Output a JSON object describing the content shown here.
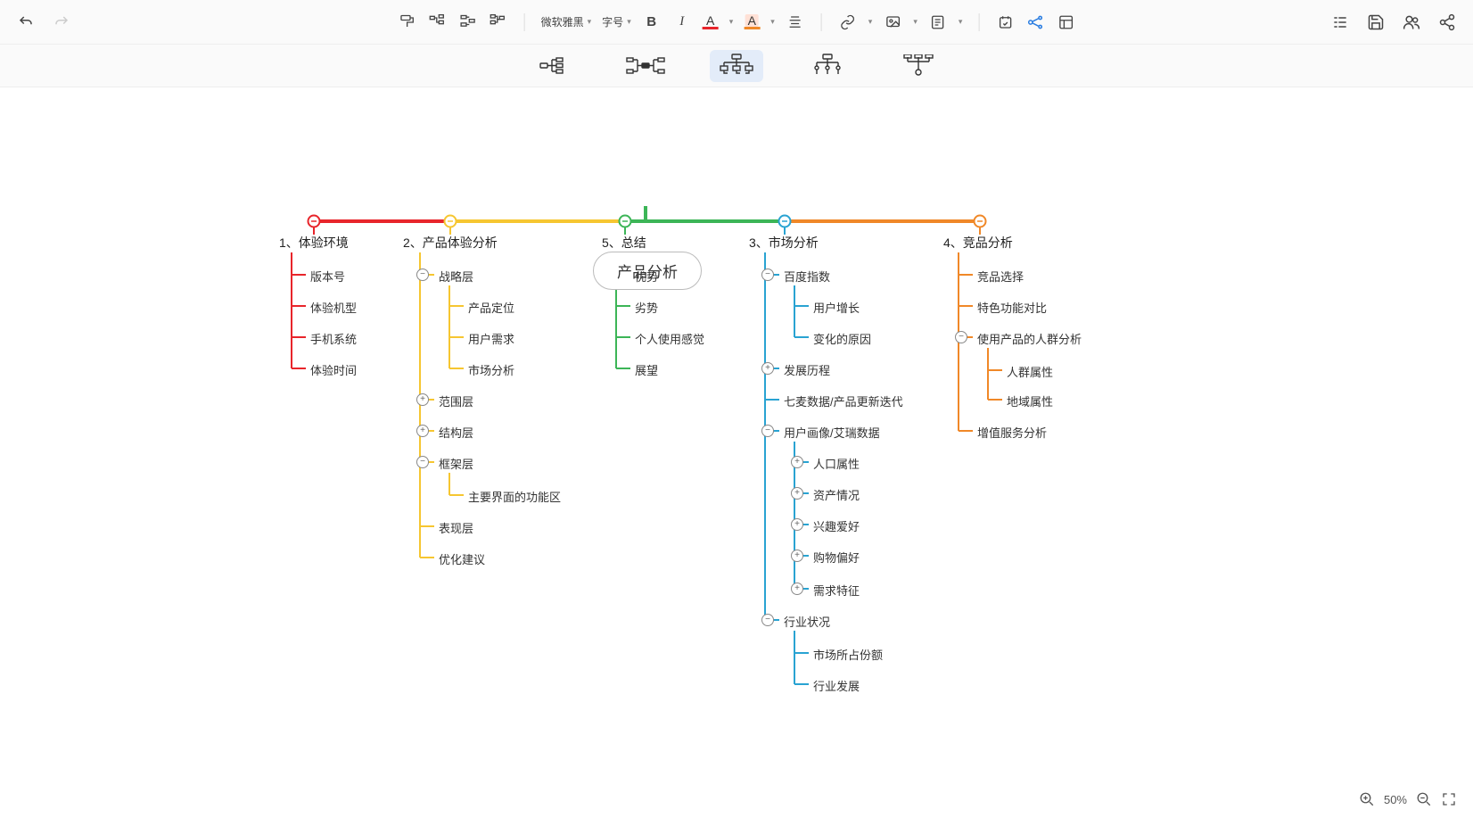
{
  "toolbar": {
    "font_family": "微软雅黑",
    "font_size_label": "字号"
  },
  "zoom": {
    "percent": "50%"
  },
  "mindmap": {
    "root": {
      "title": "产品分析"
    },
    "branches": [
      {
        "id": "b1",
        "title": "1、体验环境",
        "color": "#e8252b",
        "children": [
          {
            "label": "版本号"
          },
          {
            "label": "体验机型"
          },
          {
            "label": "手机系统"
          },
          {
            "label": "体验时间"
          }
        ]
      },
      {
        "id": "b2",
        "title": "2、产品体验分析",
        "color": "#f6c631",
        "children": [
          {
            "label": "战略层",
            "toggle": "minus",
            "children": [
              {
                "label": "产品定位"
              },
              {
                "label": "用户需求"
              },
              {
                "label": "市场分析"
              }
            ]
          },
          {
            "label": "范围层",
            "toggle": "plus"
          },
          {
            "label": "结构层",
            "toggle": "plus"
          },
          {
            "label": "框架层",
            "toggle": "minus",
            "children": [
              {
                "label": "主要界面的功能区"
              }
            ]
          },
          {
            "label": "表现层"
          },
          {
            "label": "优化建议"
          }
        ]
      },
      {
        "id": "b3",
        "title": "5、总结",
        "color": "#3cb557",
        "children": [
          {
            "label": "优势"
          },
          {
            "label": "劣势"
          },
          {
            "label": "个人使用感觉"
          },
          {
            "label": "展望"
          }
        ]
      },
      {
        "id": "b4",
        "title": "3、市场分析",
        "color": "#29a3d2",
        "children": [
          {
            "label": "百度指数",
            "toggle": "minus",
            "children": [
              {
                "label": "用户增长"
              },
              {
                "label": "变化的原因"
              }
            ]
          },
          {
            "label": "发展历程",
            "toggle": "plus"
          },
          {
            "label": "七麦数据/产品更新迭代"
          },
          {
            "label": "用户画像/艾瑞数据",
            "toggle": "minus",
            "children": [
              {
                "label": "人口属性",
                "toggle": "plus"
              },
              {
                "label": "资产情况",
                "toggle": "plus"
              },
              {
                "label": "兴趣爱好",
                "toggle": "plus"
              },
              {
                "label": "购物偏好",
                "toggle": "plus"
              },
              {
                "label": "需求特征",
                "toggle": "plus"
              }
            ]
          },
          {
            "label": "行业状况",
            "toggle": "minus",
            "children": [
              {
                "label": "市场所占份额"
              },
              {
                "label": "行业发展"
              }
            ]
          }
        ]
      },
      {
        "id": "b5",
        "title": "4、竞品分析",
        "color": "#f08828",
        "children": [
          {
            "label": "竞品选择"
          },
          {
            "label": "特色功能对比"
          },
          {
            "label": "使用产品的人群分析",
            "toggle": "minus",
            "children": [
              {
                "label": "人群属性"
              },
              {
                "label": "地域属性"
              }
            ]
          },
          {
            "label": "增值服务分析"
          }
        ]
      }
    ]
  }
}
